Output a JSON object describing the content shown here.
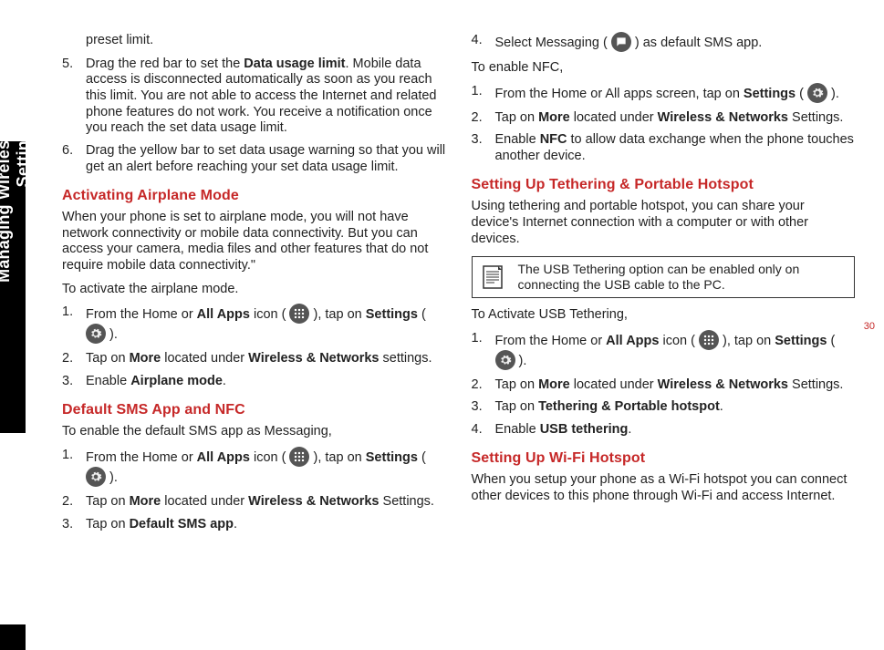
{
  "sideTab": "Managing Wireless and Network Settings",
  "pageNum": "30",
  "col1": {
    "p_preset": "preset limit.",
    "stepsA": [
      {
        "pre": "Drag the red bar to set the ",
        "bold": "Data usage limit",
        "post": ". Mobile data access is disconnected automatically as soon as you reach this limit. You are not able to access the Internet and related phone features do not work. You receive a notification once you reach the set data usage limit."
      },
      {
        "pre": "Drag the yellow bar to set data usage warning so that you will get an alert before reaching your set data usage limit.",
        "bold": "",
        "post": ""
      }
    ],
    "h1": "Activating Airplane Mode",
    "p_airplane": "When your phone is set to airplane mode, you will not have network connectivity or mobile data connectivity. But you can access your camera, media files and other features that do not require mobile data connectivity.\"",
    "p_activate": "To activate the airplane mode.",
    "stepsB": {
      "s1a": "From the Home or ",
      "s1b": "All Apps",
      "s1c": " icon (",
      "s1d": "), tap on ",
      "s1e": "Settings",
      "s1f": " (",
      "s1g": ").",
      "s2a": "Tap on ",
      "s2b": "More",
      "s2c": " located under ",
      "s2d": "Wireless & Networks",
      "s2e": " settings.",
      "s3a": "Enable ",
      "s3b": "Airplane mode",
      "s3c": "."
    },
    "h2": "Default SMS App and NFC",
    "p_sms": "To enable the default SMS app as Messaging,",
    "stepsC": {
      "s1a": "From the Home or ",
      "s1b": "All Apps",
      "s1c": " icon (",
      "s1d": "), tap on ",
      "s1e": "Settings",
      "s1f": " (",
      "s1g": ").",
      "s2a": "Tap on ",
      "s2b": "More",
      "s2c": " located under ",
      "s2d": "Wireless & Networks",
      "s2e": " Settings.",
      "s3a": "Tap on ",
      "s3b": "Default SMS app",
      "s3c": "."
    }
  },
  "col2": {
    "stepsD": {
      "s4a": "Select Messaging (",
      "s4b": ") as default SMS app."
    },
    "p_nfc": "To enable NFC,",
    "stepsE": {
      "s1a": "From the Home or All apps screen, tap on ",
      "s1b": "Settings",
      "s1c": " (",
      "s1d": ").",
      "s2a": "Tap on ",
      "s2b": "More",
      "s2c": " located under ",
      "s2d": "Wireless & Networks",
      "s2e": " Settings.",
      "s3a": "Enable ",
      "s3b": "NFC",
      "s3c": " to allow data exchange when the phone touches another device."
    },
    "h3": "Setting Up Tethering & Portable Hotspot",
    "p_tether": "Using tethering and portable hotspot, you can share your device's Internet connection with a computer or with other devices.",
    "note": "The USB Tethering option can be enabled only on connecting the USB cable to the PC.",
    "p_usb": "To Activate USB Tethering,",
    "stepsF": {
      "s1a": "From the Home or ",
      "s1b": "All Apps",
      "s1c": " icon (",
      "s1d": "), tap on ",
      "s1e": "Settings",
      "s1f": " (",
      "s1g": ").",
      "s2a": "Tap on ",
      "s2b": "More",
      "s2c": " located under ",
      "s2d": "Wireless & Networks",
      "s2e": " Settings.",
      "s3a": "Tap on ",
      "s3b": "Tethering & Portable hotspot",
      "s3c": ".",
      "s4a": "Enable ",
      "s4b": "USB tethering",
      "s4c": "."
    },
    "h4": "Setting Up Wi-Fi Hotspot",
    "p_wifi": "When you setup your phone as a Wi-Fi hotspot you can connect other devices to this phone through Wi-Fi and access Internet."
  }
}
